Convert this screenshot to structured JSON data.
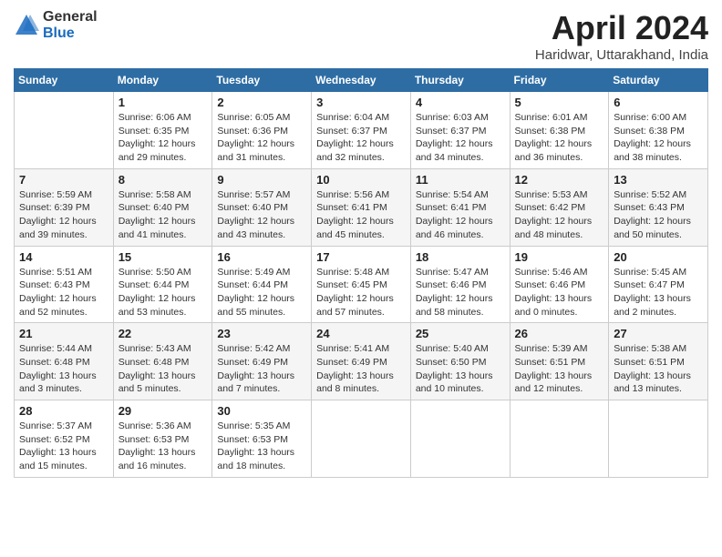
{
  "logo": {
    "general": "General",
    "blue": "Blue"
  },
  "title": "April 2024",
  "location": "Haridwar, Uttarakhand, India",
  "weekdays": [
    "Sunday",
    "Monday",
    "Tuesday",
    "Wednesday",
    "Thursday",
    "Friday",
    "Saturday"
  ],
  "weeks": [
    [
      {
        "day": "",
        "info": ""
      },
      {
        "day": "1",
        "info": "Sunrise: 6:06 AM\nSunset: 6:35 PM\nDaylight: 12 hours\nand 29 minutes."
      },
      {
        "day": "2",
        "info": "Sunrise: 6:05 AM\nSunset: 6:36 PM\nDaylight: 12 hours\nand 31 minutes."
      },
      {
        "day": "3",
        "info": "Sunrise: 6:04 AM\nSunset: 6:37 PM\nDaylight: 12 hours\nand 32 minutes."
      },
      {
        "day": "4",
        "info": "Sunrise: 6:03 AM\nSunset: 6:37 PM\nDaylight: 12 hours\nand 34 minutes."
      },
      {
        "day": "5",
        "info": "Sunrise: 6:01 AM\nSunset: 6:38 PM\nDaylight: 12 hours\nand 36 minutes."
      },
      {
        "day": "6",
        "info": "Sunrise: 6:00 AM\nSunset: 6:38 PM\nDaylight: 12 hours\nand 38 minutes."
      }
    ],
    [
      {
        "day": "7",
        "info": "Sunrise: 5:59 AM\nSunset: 6:39 PM\nDaylight: 12 hours\nand 39 minutes."
      },
      {
        "day": "8",
        "info": "Sunrise: 5:58 AM\nSunset: 6:40 PM\nDaylight: 12 hours\nand 41 minutes."
      },
      {
        "day": "9",
        "info": "Sunrise: 5:57 AM\nSunset: 6:40 PM\nDaylight: 12 hours\nand 43 minutes."
      },
      {
        "day": "10",
        "info": "Sunrise: 5:56 AM\nSunset: 6:41 PM\nDaylight: 12 hours\nand 45 minutes."
      },
      {
        "day": "11",
        "info": "Sunrise: 5:54 AM\nSunset: 6:41 PM\nDaylight: 12 hours\nand 46 minutes."
      },
      {
        "day": "12",
        "info": "Sunrise: 5:53 AM\nSunset: 6:42 PM\nDaylight: 12 hours\nand 48 minutes."
      },
      {
        "day": "13",
        "info": "Sunrise: 5:52 AM\nSunset: 6:43 PM\nDaylight: 12 hours\nand 50 minutes."
      }
    ],
    [
      {
        "day": "14",
        "info": "Sunrise: 5:51 AM\nSunset: 6:43 PM\nDaylight: 12 hours\nand 52 minutes."
      },
      {
        "day": "15",
        "info": "Sunrise: 5:50 AM\nSunset: 6:44 PM\nDaylight: 12 hours\nand 53 minutes."
      },
      {
        "day": "16",
        "info": "Sunrise: 5:49 AM\nSunset: 6:44 PM\nDaylight: 12 hours\nand 55 minutes."
      },
      {
        "day": "17",
        "info": "Sunrise: 5:48 AM\nSunset: 6:45 PM\nDaylight: 12 hours\nand 57 minutes."
      },
      {
        "day": "18",
        "info": "Sunrise: 5:47 AM\nSunset: 6:46 PM\nDaylight: 12 hours\nand 58 minutes."
      },
      {
        "day": "19",
        "info": "Sunrise: 5:46 AM\nSunset: 6:46 PM\nDaylight: 13 hours\nand 0 minutes."
      },
      {
        "day": "20",
        "info": "Sunrise: 5:45 AM\nSunset: 6:47 PM\nDaylight: 13 hours\nand 2 minutes."
      }
    ],
    [
      {
        "day": "21",
        "info": "Sunrise: 5:44 AM\nSunset: 6:48 PM\nDaylight: 13 hours\nand 3 minutes."
      },
      {
        "day": "22",
        "info": "Sunrise: 5:43 AM\nSunset: 6:48 PM\nDaylight: 13 hours\nand 5 minutes."
      },
      {
        "day": "23",
        "info": "Sunrise: 5:42 AM\nSunset: 6:49 PM\nDaylight: 13 hours\nand 7 minutes."
      },
      {
        "day": "24",
        "info": "Sunrise: 5:41 AM\nSunset: 6:49 PM\nDaylight: 13 hours\nand 8 minutes."
      },
      {
        "day": "25",
        "info": "Sunrise: 5:40 AM\nSunset: 6:50 PM\nDaylight: 13 hours\nand 10 minutes."
      },
      {
        "day": "26",
        "info": "Sunrise: 5:39 AM\nSunset: 6:51 PM\nDaylight: 13 hours\nand 12 minutes."
      },
      {
        "day": "27",
        "info": "Sunrise: 5:38 AM\nSunset: 6:51 PM\nDaylight: 13 hours\nand 13 minutes."
      }
    ],
    [
      {
        "day": "28",
        "info": "Sunrise: 5:37 AM\nSunset: 6:52 PM\nDaylight: 13 hours\nand 15 minutes."
      },
      {
        "day": "29",
        "info": "Sunrise: 5:36 AM\nSunset: 6:53 PM\nDaylight: 13 hours\nand 16 minutes."
      },
      {
        "day": "30",
        "info": "Sunrise: 5:35 AM\nSunset: 6:53 PM\nDaylight: 13 hours\nand 18 minutes."
      },
      {
        "day": "",
        "info": ""
      },
      {
        "day": "",
        "info": ""
      },
      {
        "day": "",
        "info": ""
      },
      {
        "day": "",
        "info": ""
      }
    ]
  ]
}
